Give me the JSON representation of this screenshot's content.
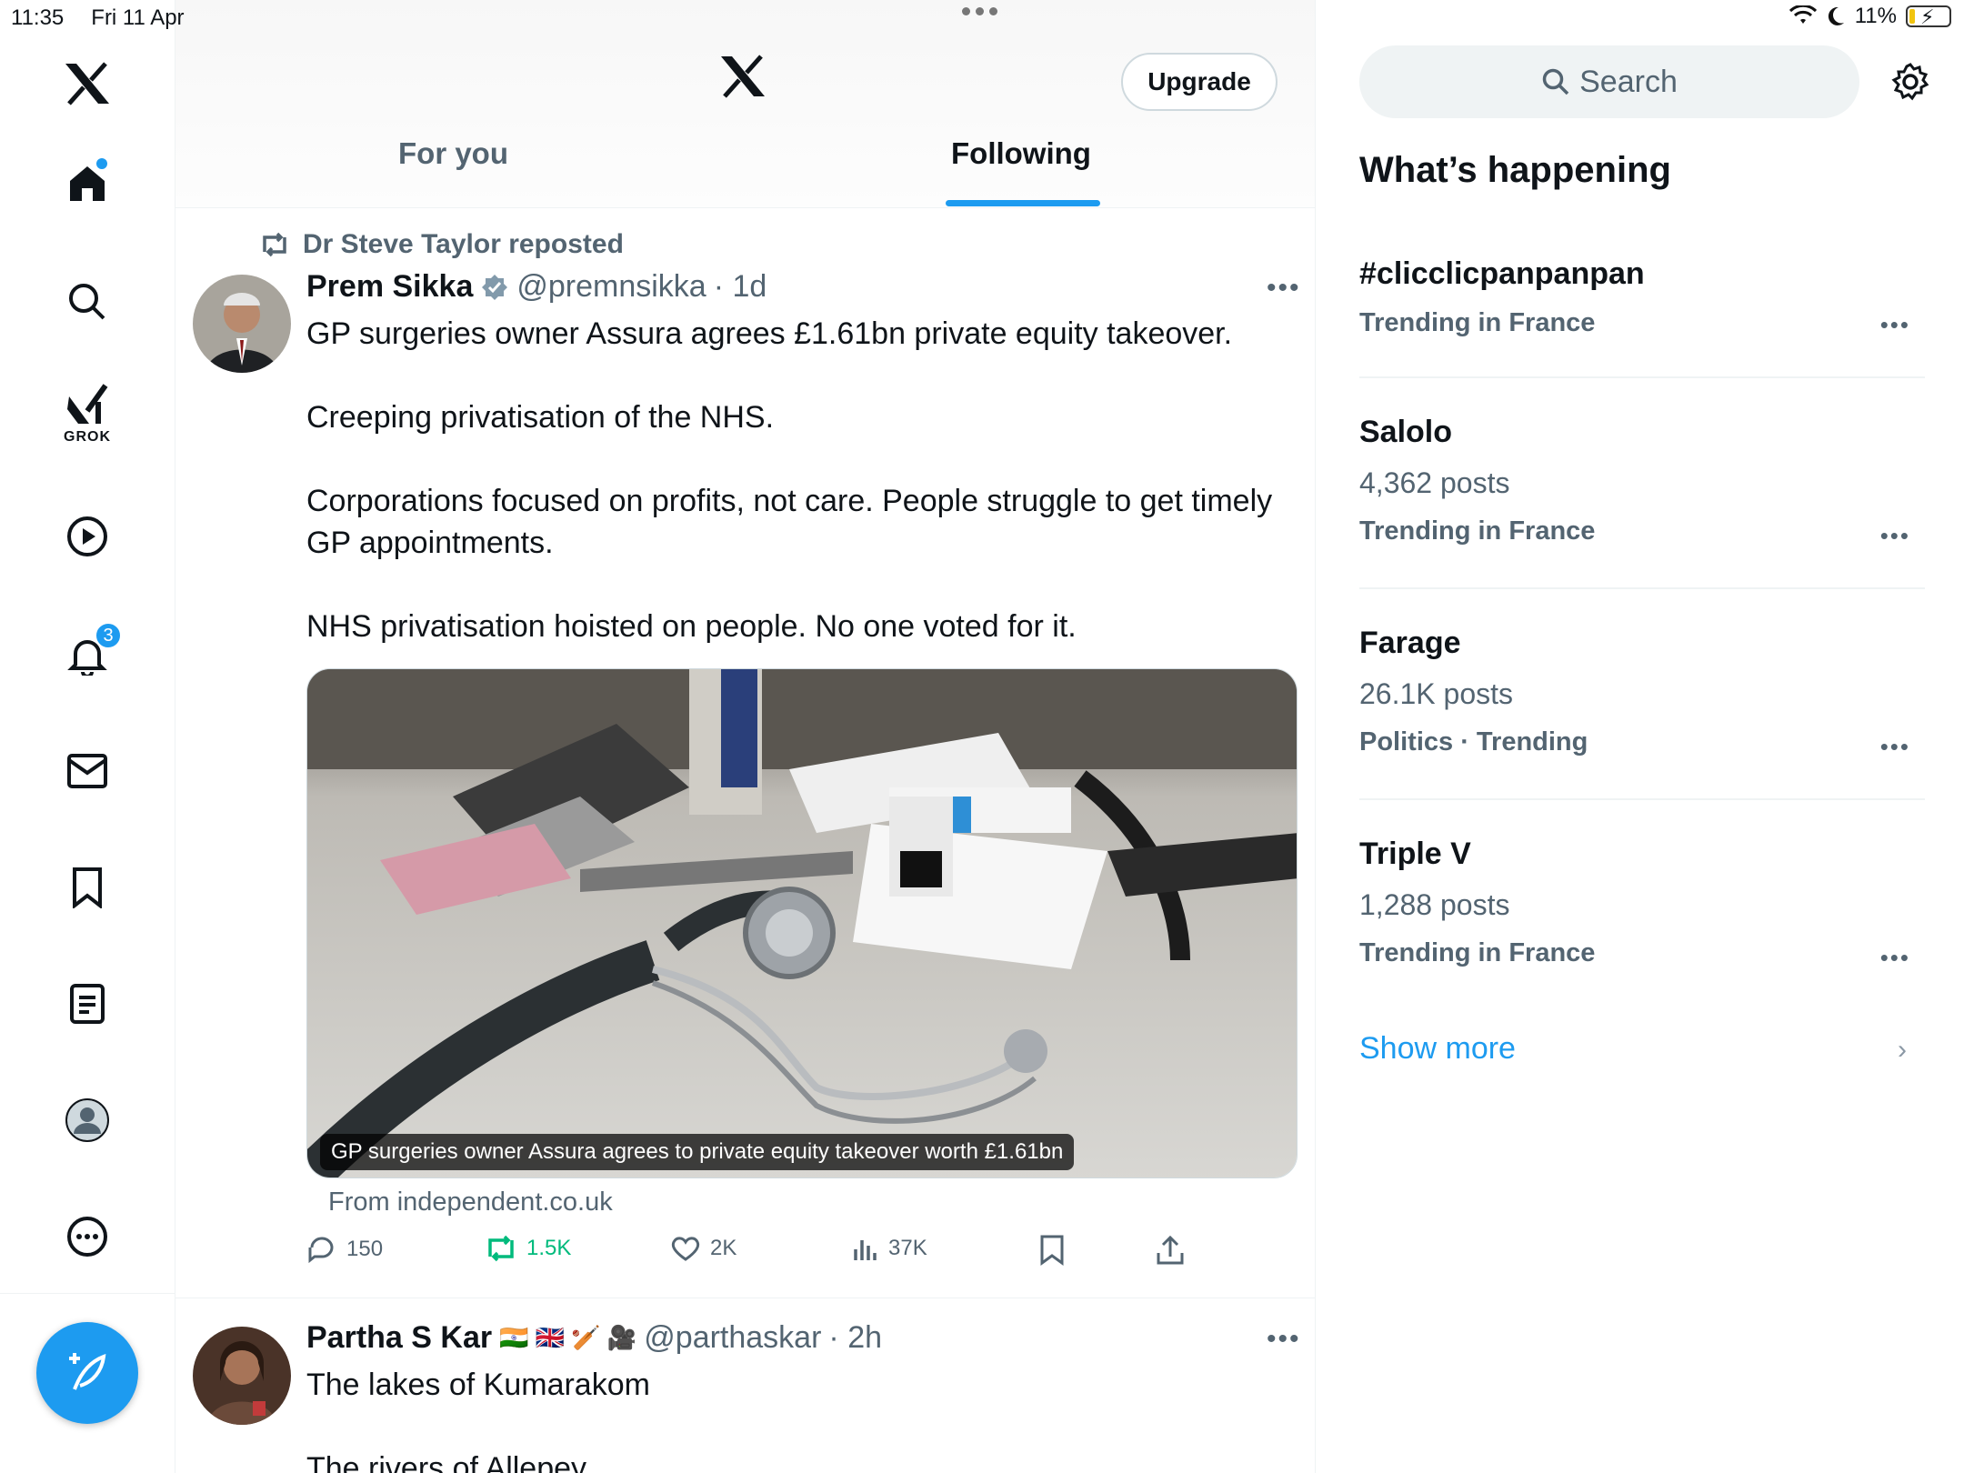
{
  "status_bar": {
    "time": "11:35",
    "date": "Fri 11 Apr",
    "battery": "11%"
  },
  "nav": {
    "grok_label": "GROK",
    "notifications_badge": "3"
  },
  "header": {
    "upgrade_label": "Upgrade",
    "tabs": [
      {
        "label": "For you",
        "active": false
      },
      {
        "label": "Following",
        "active": true
      }
    ]
  },
  "posts": [
    {
      "reposted_by": "Dr Steve Taylor reposted",
      "name": "Prem Sikka",
      "verified": true,
      "handle": "@premnsikka",
      "time": "· 1d",
      "paragraphs": [
        "GP surgeries owner Assura agrees £1.61bn private equity takeover.",
        "Creeping privatisation of the NHS.",
        "Corporations focused on profits, not care. People struggle to get timely GP appointments.",
        "NHS privatisation hoisted on people. No one voted for it."
      ],
      "media_caption": "GP surgeries owner Assura agrees to private equity takeover worth £1.61bn",
      "source": "From independent.co.uk",
      "stats": {
        "replies": "150",
        "reposts": "1.5K",
        "likes": "2K",
        "views": "37K"
      }
    },
    {
      "name": "Partha S Kar",
      "flags": "🇮🇳 🇬🇧 🏏 🎥",
      "handle": "@parthaskar",
      "time": "· 2h",
      "paragraphs": [
        "The lakes of Kumarakom",
        "The rivers of Allepey"
      ]
    }
  ],
  "sidebar": {
    "search_placeholder": "Search",
    "title": "What’s happening",
    "trends": [
      {
        "name": "#clicclicpanpanpan",
        "count": "",
        "meta": "Trending in France"
      },
      {
        "name": "Salolo",
        "count": "4,362 posts",
        "meta": "Trending in France"
      },
      {
        "name": "Farage",
        "count": "26.1K posts",
        "meta": "Politics · Trending"
      },
      {
        "name": "Triple V",
        "count": "1,288 posts",
        "meta": "Trending in France"
      }
    ],
    "show_more": "Show more"
  },
  "colors": {
    "accent": "#1d9bf0",
    "text_secondary": "#536471",
    "repost_green": "#00ba7c"
  }
}
